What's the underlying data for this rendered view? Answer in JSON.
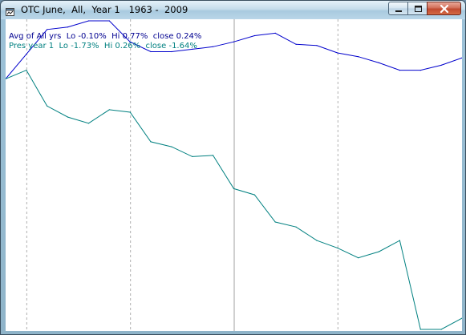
{
  "window": {
    "title": "OTC June,  All,  Year 1   1963 -  2009",
    "icon": "chart-window-icon",
    "controls": {
      "minimize_icon": "minimize-icon",
      "maximize_icon": "maximize-icon",
      "close_icon": "close-icon"
    }
  },
  "legend": {
    "avg": "Avg of All yrs  Lo -0.10%  Hi 0.77%  close 0.24%",
    "pres": "Pres year 1  Lo -1.73%  Hi 0.26%  close -1.64%"
  },
  "colors": {
    "avg_line": "#0000cc",
    "pres_line": "#008080",
    "grid_dotted": "#b0b0b0",
    "grid_solid": "#a0a0a0"
  },
  "chart_data": {
    "type": "line",
    "title": "",
    "xlabel": "",
    "ylabel": "",
    "grid": "vertical",
    "vertical_dividers": [
      {
        "after_point": 1,
        "style": "dotted"
      },
      {
        "after_point": 6,
        "style": "dotted"
      },
      {
        "after_point": 11,
        "style": "solid"
      },
      {
        "after_point": 16,
        "style": "dotted"
      }
    ],
    "ylim": [
      -1.73,
      0.77
    ],
    "series": [
      {
        "name": "Avg of All yrs",
        "values": [
          0.3,
          0.5,
          0.7,
          0.72,
          0.77,
          0.77,
          0.6,
          0.52,
          0.52,
          0.54,
          0.56,
          0.6,
          0.65,
          0.67,
          0.58,
          0.57,
          0.51,
          0.48,
          0.43,
          0.37,
          0.37,
          0.41,
          0.47
        ]
      },
      {
        "name": "Pres year 1",
        "values": [
          0.3,
          0.37,
          0.08,
          -0.01,
          -0.06,
          0.05,
          0.03,
          -0.21,
          -0.25,
          -0.33,
          -0.32,
          -0.59,
          -0.64,
          -0.86,
          -0.9,
          -1.01,
          -1.07,
          -1.15,
          -1.1,
          -1.01,
          -1.73,
          -1.73,
          -1.64
        ]
      }
    ]
  }
}
